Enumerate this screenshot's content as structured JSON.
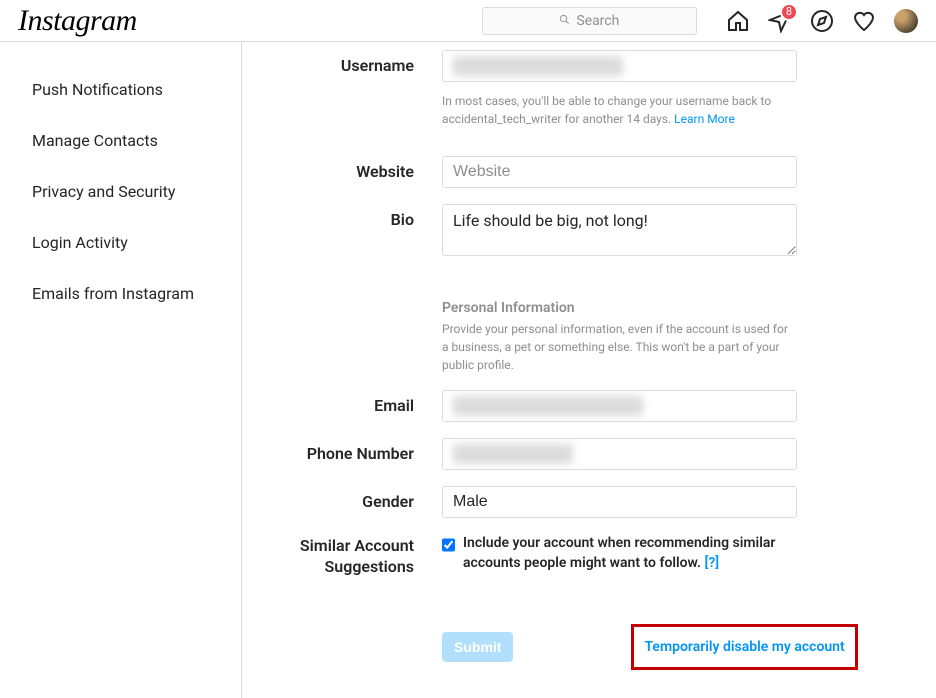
{
  "header": {
    "logo": "Instagram",
    "search_placeholder": "Search",
    "badge_count": "8"
  },
  "sidebar": {
    "items": [
      {
        "label": "Push Notifications"
      },
      {
        "label": "Manage Contacts"
      },
      {
        "label": "Privacy and Security"
      },
      {
        "label": "Login Activity"
      },
      {
        "label": "Emails from Instagram"
      }
    ]
  },
  "form": {
    "username": {
      "label": "Username",
      "value": "",
      "help_prefix": "In most cases, you'll be able to change your username back to accidental_tech_writer for another 14 days. ",
      "help_link": "Learn More"
    },
    "website": {
      "label": "Website",
      "placeholder": "Website",
      "value": ""
    },
    "bio": {
      "label": "Bio",
      "value": "Life should be big, not long!"
    },
    "personal_info": {
      "title": "Personal Information",
      "sub": "Provide your personal information, even if the account is used for a business, a pet or something else. This won't be a part of your public profile."
    },
    "email": {
      "label": "Email",
      "value": ""
    },
    "phone": {
      "label": "Phone Number",
      "value": ""
    },
    "gender": {
      "label": "Gender",
      "value": "Male"
    },
    "similar": {
      "label_line1": "Similar Account",
      "label_line2": "Suggestions",
      "checkbox_label": "Include your account when recommending similar accounts people might want to follow.  ",
      "help": "[?]"
    },
    "submit": "Submit",
    "disable": "Temporarily disable my account"
  }
}
